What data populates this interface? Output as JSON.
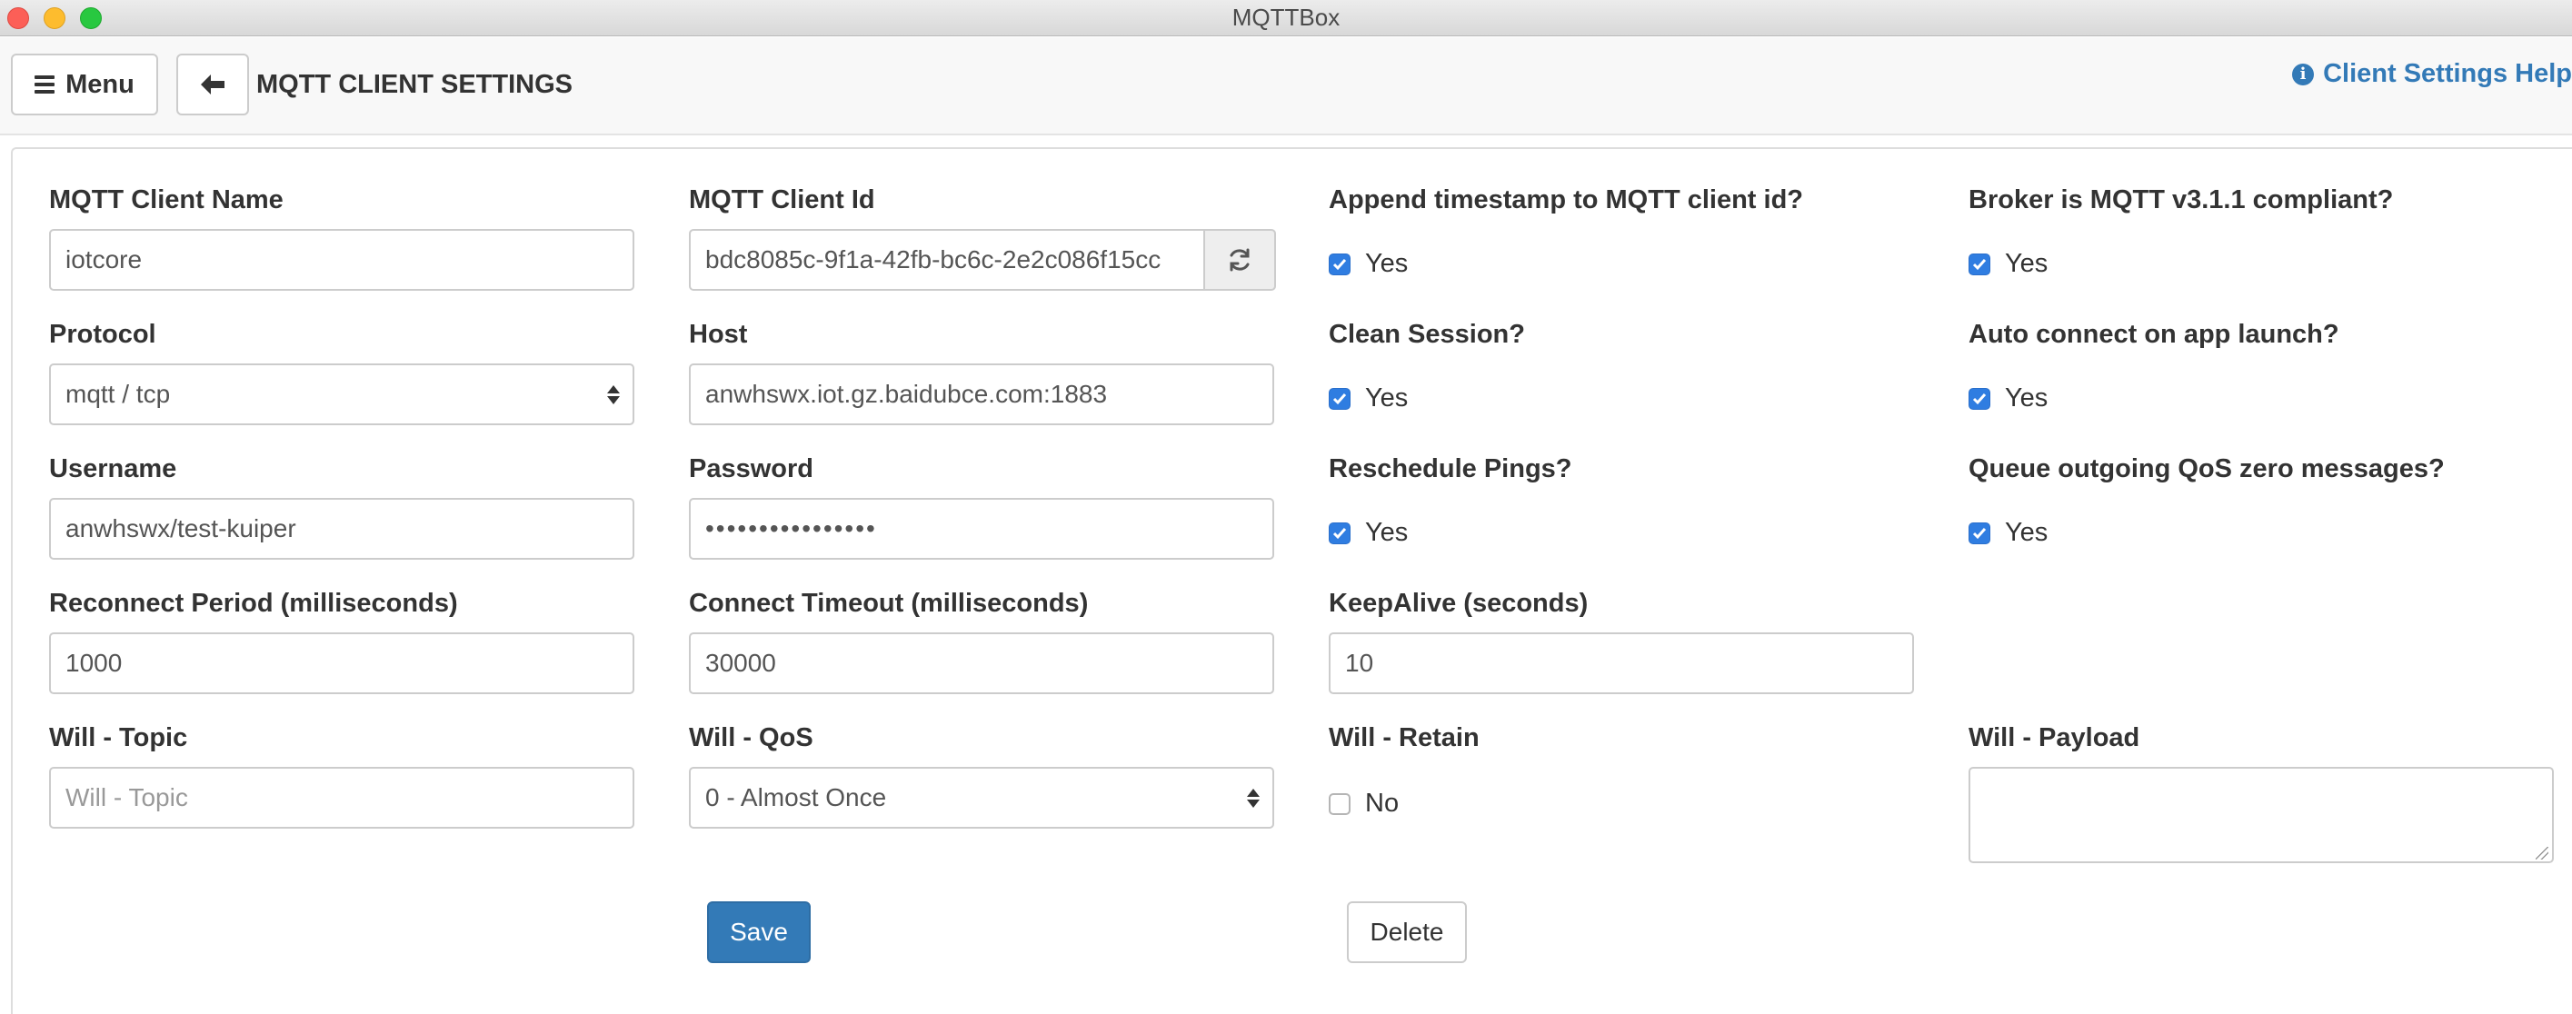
{
  "window": {
    "title": "MQTTBox"
  },
  "header": {
    "menu_label": "Menu",
    "page_title": "MQTT CLIENT SETTINGS",
    "help_label": "Client Settings Help"
  },
  "form": {
    "client_name": {
      "label": "MQTT Client Name",
      "value": "iotcore"
    },
    "client_id": {
      "label": "MQTT Client Id",
      "value": "bdc8085c-9f1a-42fb-bc6c-2e2c086f15cc"
    },
    "append_timestamp": {
      "label": "Append timestamp to MQTT client id?",
      "option": "Yes",
      "checked": true
    },
    "broker_compliant": {
      "label": "Broker is MQTT v3.1.1 compliant?",
      "option": "Yes",
      "checked": true
    },
    "protocol": {
      "label": "Protocol",
      "value": "mqtt / tcp"
    },
    "host": {
      "label": "Host",
      "value": "anwhswx.iot.gz.baidubce.com:1883"
    },
    "clean_session": {
      "label": "Clean Session?",
      "option": "Yes",
      "checked": true
    },
    "auto_connect": {
      "label": "Auto connect on app launch?",
      "option": "Yes",
      "checked": true
    },
    "username": {
      "label": "Username",
      "value": "anwhswx/test-kuiper"
    },
    "password": {
      "label": "Password",
      "value": "••••••••••••••••"
    },
    "reschedule_pings": {
      "label": "Reschedule Pings?",
      "option": "Yes",
      "checked": true
    },
    "queue_qos_zero": {
      "label": "Queue outgoing QoS zero messages?",
      "option": "Yes",
      "checked": true
    },
    "reconnect_period": {
      "label": "Reconnect Period (milliseconds)",
      "value": "1000"
    },
    "connect_timeout": {
      "label": "Connect Timeout (milliseconds)",
      "value": "30000"
    },
    "keepalive": {
      "label": "KeepAlive (seconds)",
      "value": "10"
    },
    "will_topic": {
      "label": "Will - Topic",
      "value": "",
      "placeholder": "Will - Topic"
    },
    "will_qos": {
      "label": "Will - QoS",
      "value": "0 - Almost Once"
    },
    "will_retain": {
      "label": "Will - Retain",
      "option": "No",
      "checked": false
    },
    "will_payload": {
      "label": "Will - Payload",
      "value": ""
    },
    "save_label": "Save",
    "delete_label": "Delete"
  },
  "colors": {
    "primary": "#337ab7",
    "checkbox_checked": "#2f7de1",
    "titlebar": "#e3e3e3"
  },
  "icons": {
    "menu": "hamburger-icon",
    "back": "arrow-left-icon",
    "help": "info-circle-icon",
    "regenerate": "refresh-icon",
    "checkbox": "checkmark-icon"
  }
}
